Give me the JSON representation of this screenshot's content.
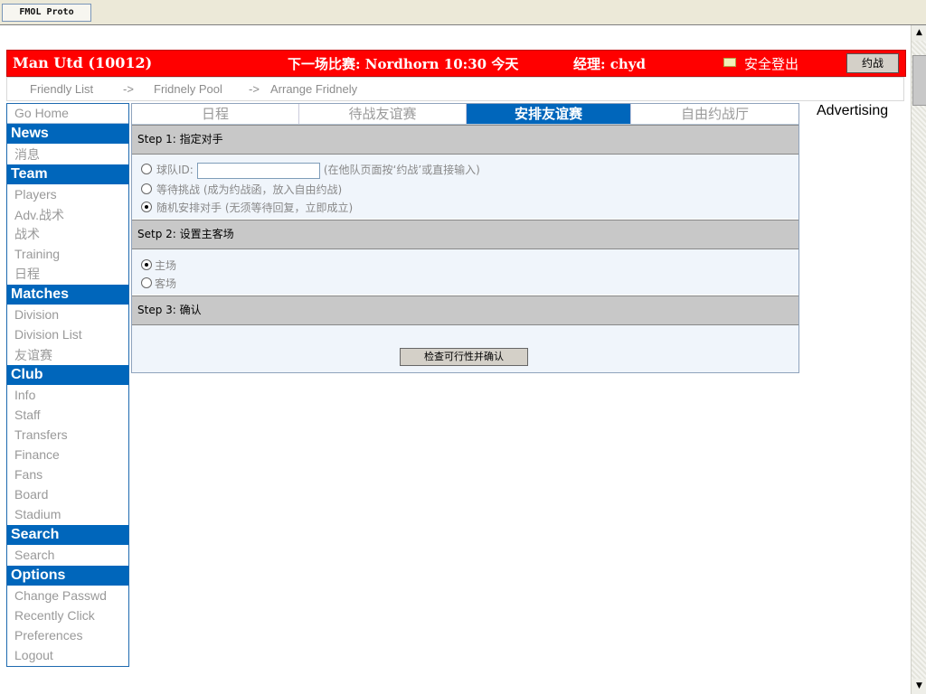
{
  "window_tab": {
    "title": "FMOL Proto"
  },
  "header": {
    "team": "Man Utd (10012)",
    "next_match": "下一场比赛: Nordhorn 10:30 今天",
    "manager": "经理: chyd",
    "logout": "安全登出",
    "challenge_button": "约战",
    "mail_icon": "envelope-icon"
  },
  "breadcrumb": {
    "items": [
      "Friendly List",
      "Fridnely Pool",
      "Arrange Fridnely"
    ],
    "separator": "->"
  },
  "sidebar": {
    "home": "Go Home",
    "sections": [
      {
        "title": "News",
        "items": [
          "消息"
        ]
      },
      {
        "title": "Team",
        "items": [
          "Players",
          "Adv.战术",
          "战术",
          "Training",
          "日程"
        ]
      },
      {
        "title": "Matches",
        "items": [
          "Division",
          "Division List",
          "友谊赛"
        ]
      },
      {
        "title": "Club",
        "items": [
          "Info",
          "Staff",
          "Transfers",
          "Finance",
          "Fans",
          "Board",
          "Stadium"
        ]
      },
      {
        "title": "Search",
        "items": [
          "Search"
        ]
      },
      {
        "title": "Options",
        "items": [
          "Change Passwd",
          "Recently Click",
          "Preferences",
          "Logout"
        ]
      }
    ]
  },
  "tabs": [
    {
      "label": "日程",
      "active": false
    },
    {
      "label": "待战友谊赛",
      "active": false
    },
    {
      "label": "安排友谊赛",
      "active": true
    },
    {
      "label": "自由约战厅",
      "active": false
    }
  ],
  "step1": {
    "title": "Step 1: 指定对手",
    "option1_label": "球队ID:",
    "option1_hint": "(在他队页面按‘约战’或直接输入)",
    "option1_value": "",
    "option2": "等待挑战 (成为约战函，放入自由约战)",
    "option3": "随机安排对手 (无须等待回复，立即成立)",
    "selected": 3
  },
  "step2": {
    "title": "Setp 2: 设置主客场",
    "home": "主场",
    "away": "客场",
    "selected": "home"
  },
  "step3": {
    "title": "Step 3: 确认",
    "button": "检查可行性并确认"
  },
  "advertising": "Advertising",
  "colors": {
    "header_red": "#ff0000",
    "nav_blue": "#0066bb",
    "panel_bg": "#f0f5fb"
  }
}
